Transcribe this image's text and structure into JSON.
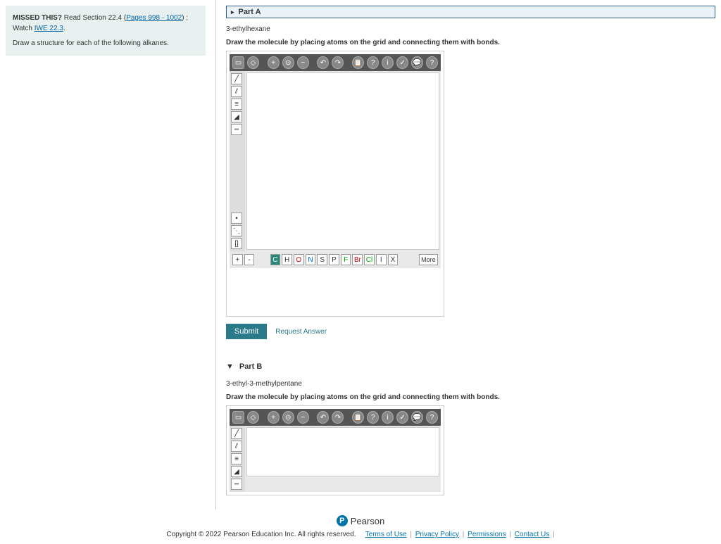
{
  "left": {
    "missed_label": "MISSED THIS?",
    "read_section": "Read Section 22.4 (",
    "pages_link": "Pages 998 - 1002",
    "watch_text": ") ; Watch ",
    "iwe_link": "IWE 22.3",
    "period": ".",
    "prompt": "Draw a structure for each of the following alkanes."
  },
  "partA": {
    "title": "Part A",
    "compound": "3-ethylhexane",
    "instruction": "Draw the molecule by placing atoms on the grid and connecting them with bonds.",
    "atoms": {
      "c": "C",
      "h": "H",
      "o": "O",
      "n": "N",
      "s": "S",
      "p": "P",
      "f": "F",
      "br": "Br",
      "cl": "Cl",
      "i": "I",
      "x": "X",
      "more": "More"
    },
    "charge": {
      "plus": "+",
      "minus": "-"
    },
    "submit": "Submit",
    "request": "Request Answer"
  },
  "partB": {
    "title": "Part B",
    "compound": "3-ethyl-3-methylpentane",
    "instruction": "Draw the molecule by placing atoms on the grid and connecting them with bonds."
  },
  "footer": {
    "brand": "Pearson",
    "copyright": "Copyright © 2022 Pearson Education Inc. All rights reserved.",
    "terms": "Terms of Use",
    "privacy": "Privacy Policy",
    "permissions": "Permissions",
    "contact": "Contact Us"
  }
}
